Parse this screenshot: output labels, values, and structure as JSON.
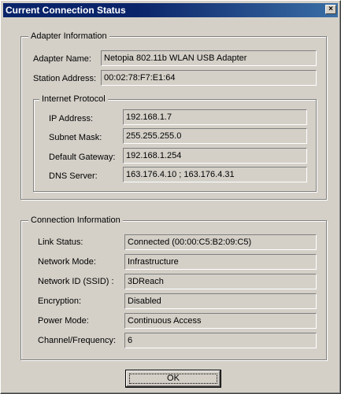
{
  "window": {
    "title": "Current Connection Status",
    "close_glyph": "×"
  },
  "adapter": {
    "group_label": "Adapter Information",
    "name_label": "Adapter Name:",
    "name_value": "Netopia 802.11b WLAN USB Adapter",
    "station_label": "Station Address:",
    "station_value": "00:02:78:F7:E1:64"
  },
  "internet_protocol": {
    "group_label": "Internet Protocol",
    "ip_label": "IP Address:",
    "ip_value": "192.168.1.7",
    "mask_label": "Subnet Mask:",
    "mask_value": "255.255.255.0",
    "gateway_label": "Default Gateway:",
    "gateway_value": "192.168.1.254",
    "dns_label": "DNS Server:",
    "dns_value": "163.176.4.10 ; 163.176.4.31"
  },
  "connection": {
    "group_label": "Connection Information",
    "link_label": "Link Status:",
    "link_value": "Connected (00:00:C5:B2:09:C5)",
    "mode_label": "Network Mode:",
    "mode_value": "Infrastructure",
    "ssid_label": "Network ID (SSID) :",
    "ssid_value": "3DReach",
    "enc_label": "Encryption:",
    "enc_value": "Disabled",
    "power_label": "Power Mode:",
    "power_value": "Continuous Access",
    "channel_label": "Channel/Frequency:",
    "channel_value": "6"
  },
  "buttons": {
    "ok_label": "OK"
  },
  "colors": {
    "titlebar": "#0a246a",
    "face": "#d4d0c8"
  }
}
